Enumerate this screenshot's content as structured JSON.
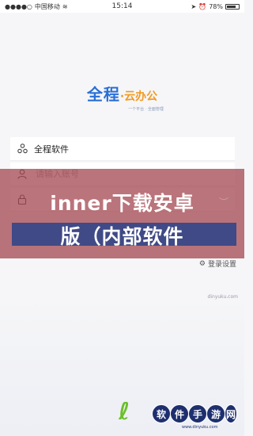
{
  "status_bar": {
    "carrier": "中国移动",
    "time": "15:14",
    "battery": "78%",
    "battery_level": 0.78
  },
  "logo": {
    "main": "全程",
    "dot": "·",
    "sub": "云办公",
    "tagline": "一个平台 · 全面管理"
  },
  "login": {
    "company_value": "全程软件",
    "account_placeholder": "请输入账号"
  },
  "banner": {
    "line1": "inner下载安卓",
    "line2": "版（内部软件"
  },
  "settings": {
    "label": "登录设置"
  },
  "watermark": {
    "url_top": "dinyuku.com",
    "chars": [
      "软",
      "件",
      "手",
      "游",
      "网"
    ],
    "url_bottom": "www.dinyuku.com"
  },
  "colors": {
    "brand_blue": "#2a6fd6",
    "brand_orange": "#f29a1f",
    "banner": "#a03e48",
    "highlight": "#3f4a86"
  }
}
